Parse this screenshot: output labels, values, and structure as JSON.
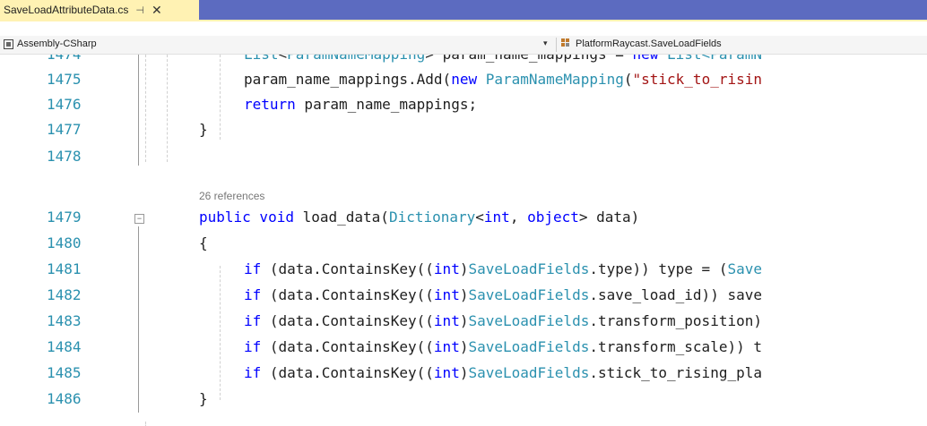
{
  "tab": {
    "filename": "SaveLoadAttributeData.cs",
    "pin_glyph": "⊣",
    "close_glyph": "✕"
  },
  "navbar": {
    "project": "Assembly-CSharp",
    "member": "PlatformRaycast.SaveLoadFields",
    "dropdown_glyph": "▾"
  },
  "codelens": "26 references",
  "lines": [
    {
      "num": "1474",
      "tokens": [
        [
          "ty",
          "List"
        ],
        [
          "",
          "<"
        ],
        [
          "ty",
          "ParamNameMapping"
        ],
        [
          "",
          "> param_name_mappings = "
        ],
        [
          "kw",
          "new"
        ],
        [
          "",
          ""
        ],
        [
          "ty",
          " List<ParamN"
        ]
      ]
    },
    {
      "num": "1475",
      "tokens": [
        [
          "",
          "param_name_mappings.Add("
        ],
        [
          "kw",
          "new"
        ],
        [
          "",
          ""
        ],
        [
          "ty",
          " ParamNameMapping"
        ],
        [
          "",
          "("
        ],
        [
          "st",
          "\"stick_to_risin"
        ]
      ]
    },
    {
      "num": "1476",
      "tokens": [
        [
          "kw",
          "return"
        ],
        [
          "",
          " param_name_mappings;"
        ]
      ]
    },
    {
      "num": "1477",
      "tokens": [
        [
          "",
          "}"
        ]
      ]
    },
    {
      "num": "1478",
      "tokens": []
    },
    {
      "num": "1479",
      "tokens": [
        [
          "kw",
          "public void"
        ],
        [
          "",
          " load_data("
        ],
        [
          "ty",
          "Dictionary"
        ],
        [
          "",
          "<"
        ],
        [
          "kw",
          "int"
        ],
        [
          "",
          ", "
        ],
        [
          "kw",
          "object"
        ],
        [
          "",
          "> data)"
        ]
      ]
    },
    {
      "num": "1480",
      "tokens": [
        [
          "",
          "{"
        ]
      ]
    },
    {
      "num": "1481",
      "tokens": [
        [
          "kw",
          "if"
        ],
        [
          "",
          " (data.ContainsKey(("
        ],
        [
          "kw",
          "int"
        ],
        [
          "",
          ")"
        ],
        [
          "ty",
          "SaveLoadFields"
        ],
        [
          "",
          ".type)) type = ("
        ],
        [
          "ty",
          "Save"
        ]
      ]
    },
    {
      "num": "1482",
      "tokens": [
        [
          "kw",
          "if"
        ],
        [
          "",
          " (data.ContainsKey(("
        ],
        [
          "kw",
          "int"
        ],
        [
          "",
          ")"
        ],
        [
          "ty",
          "SaveLoadFields"
        ],
        [
          "",
          ".save_load_id)) save"
        ]
      ]
    },
    {
      "num": "1483",
      "tokens": [
        [
          "kw",
          "if"
        ],
        [
          "",
          " (data.ContainsKey(("
        ],
        [
          "kw",
          "int"
        ],
        [
          "",
          ")"
        ],
        [
          "ty",
          "SaveLoadFields"
        ],
        [
          "",
          ".transform_position)"
        ]
      ]
    },
    {
      "num": "1484",
      "tokens": [
        [
          "kw",
          "if"
        ],
        [
          "",
          " (data.ContainsKey(("
        ],
        [
          "kw",
          "int"
        ],
        [
          "",
          ")"
        ],
        [
          "ty",
          "SaveLoadFields"
        ],
        [
          "",
          ".transform_scale)) t"
        ]
      ]
    },
    {
      "num": "1485",
      "tokens": [
        [
          "kw",
          "if"
        ],
        [
          "",
          " (data.ContainsKey(("
        ],
        [
          "kw",
          "int"
        ],
        [
          "",
          ")"
        ],
        [
          "ty",
          "SaveLoadFields"
        ],
        [
          "",
          ".stick_to_rising_pla"
        ]
      ]
    },
    {
      "num": "1486",
      "tokens": [
        [
          "",
          "}"
        ]
      ]
    }
  ],
  "fold_glyph": "−",
  "colors": {
    "tab_active": "#fff2b3",
    "tabbar": "#5c6bc0",
    "keyword": "#0000ff",
    "type": "#2b91af",
    "string": "#a31515",
    "line_number": "#2b91af"
  }
}
